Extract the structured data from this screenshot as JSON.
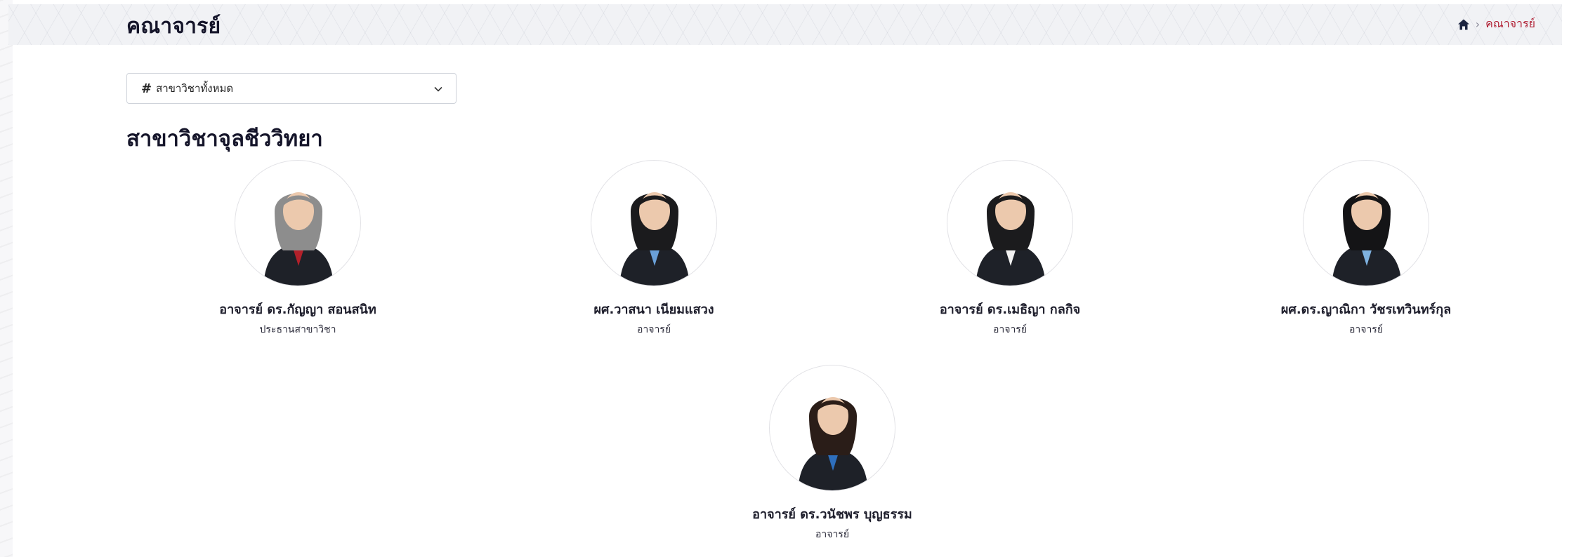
{
  "header": {
    "title": "คณาจารย์",
    "breadcrumb": {
      "home_icon": "home-icon",
      "current": "คณาจารย์"
    }
  },
  "filter": {
    "hash": "#",
    "label": "สาขาวิชาทั้งหมด",
    "icon": "chevron-down-icon"
  },
  "section": {
    "title": "สาขาวิชาจุลชีววิทยา"
  },
  "faculty": [
    {
      "name": "อาจารย์ ดร.กัญญา สอนสนิท",
      "role": "ประธานสาขาวิชา",
      "hair": "#8d8d8d",
      "shirt": "#b3202a"
    },
    {
      "name": "ผศ.วาสนา เนียมแสวง",
      "role": "อาจารย์",
      "hair": "#1b1b1d",
      "shirt": "#6aa0d8"
    },
    {
      "name": "อาจารย์ ดร.เมธิญา กลกิจ",
      "role": "อาจารย์",
      "hair": "#1b1b1d",
      "shirt": "#f2f2f2"
    },
    {
      "name": "ผศ.ดร.ญาณิกา วัชรเทวินทร์กุล",
      "role": "อาจารย์",
      "hair": "#141416",
      "shirt": "#7fb2e0"
    },
    {
      "name": "อาจารย์ ดร.วนัชพร บุญธรรม",
      "role": "อาจารย์",
      "hair": "#2a1d18",
      "shirt": "#2e6fbd"
    }
  ]
}
